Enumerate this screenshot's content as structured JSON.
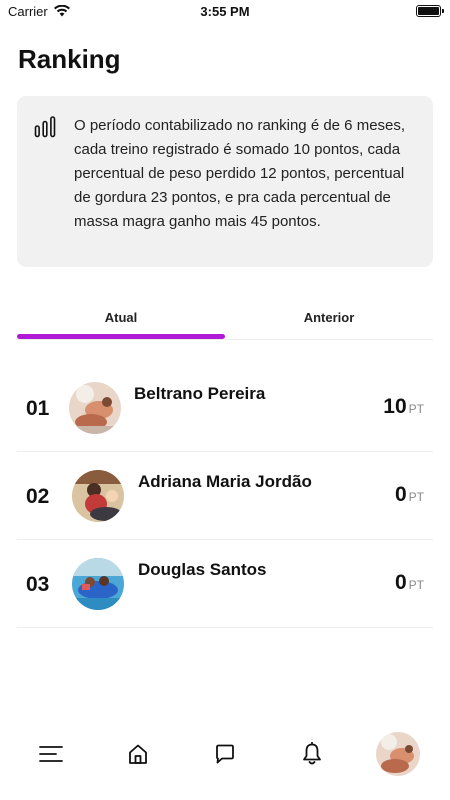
{
  "status_bar": {
    "carrier": "Carrier",
    "time": "3:55 PM"
  },
  "page": {
    "title": "Ranking"
  },
  "info": {
    "icon": "bar-chart-icon",
    "text": "O período contabilizado no ranking é de 6 meses, cada treino registrado é somado 10 pontos, cada percentual de peso perdido 12 pontos, percentual de gordura 23 pontos, e pra cada percentual de massa magra ganho mais 45 pontos."
  },
  "tabs": [
    {
      "label": "Atual",
      "active": true
    },
    {
      "label": "Anterior",
      "active": false
    }
  ],
  "accent_color": "#b01ad6",
  "ranking": [
    {
      "position": "01",
      "name": "Beltrano Pereira",
      "points": "10",
      "unit": "PT"
    },
    {
      "position": "02",
      "name": "Adriana Maria Jordão",
      "points": "0",
      "unit": "PT"
    },
    {
      "position": "03",
      "name": "Douglas Santos",
      "points": "0",
      "unit": "PT"
    }
  ],
  "bottom_nav": [
    "menu-icon",
    "home-icon",
    "chat-icon",
    "bell-icon",
    "profile-avatar"
  ]
}
